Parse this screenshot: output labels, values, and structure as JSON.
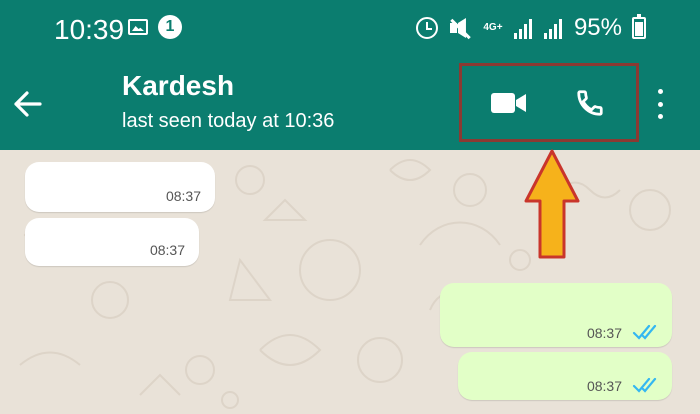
{
  "status_bar": {
    "time": "10:39",
    "notification_badge": "1",
    "network": "4G+",
    "battery": "95%"
  },
  "header": {
    "contact_name": "Kardesh",
    "last_seen": "last seen today at 10:36"
  },
  "messages": [
    {
      "direction": "in",
      "time": "08:37"
    },
    {
      "direction": "in",
      "time": "08:37"
    },
    {
      "direction": "out",
      "time": "08:37",
      "status": "read"
    },
    {
      "direction": "out",
      "time": "08:37",
      "status": "read"
    }
  ],
  "colors": {
    "header": "#0b7d6f",
    "highlight_box": "#8b3a32",
    "arrow": "#f6b21b",
    "outgoing_bubble": "#e2ffc7",
    "read_ticks": "#34b7f1"
  }
}
